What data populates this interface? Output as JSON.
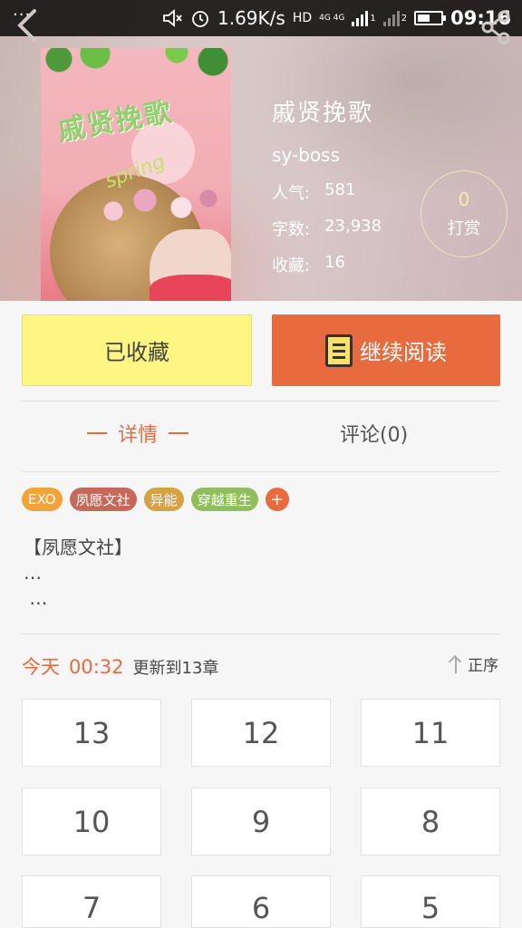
{
  "status_bar": {
    "notification_dots": "···",
    "net_speed": "1.69K/s",
    "hd_label": "HD",
    "network_label": "4G 4G",
    "sim_labels": [
      "1",
      "2"
    ],
    "time": "09:16"
  },
  "book": {
    "title": "戚贤挽歌",
    "author": "sy-boss",
    "stats": [
      {
        "label": "人气:",
        "value": "581"
      },
      {
        "label": "字数:",
        "value": "23,938"
      },
      {
        "label": "收藏:",
        "value": "16"
      }
    ],
    "cover_title": "戚贤挽歌",
    "cover_subtitle": "spring"
  },
  "tip": {
    "count": "0",
    "label": "打赏"
  },
  "actions": {
    "favorited_label": "已收藏",
    "continue_label": "继续阅读"
  },
  "tabs": {
    "detail": "详情",
    "comments": "评论(0)"
  },
  "tags": [
    {
      "label": "EXO",
      "color": "#f0a43a"
    },
    {
      "label": "夙愿文社",
      "color": "#c46a58"
    },
    {
      "label": "异能",
      "color": "#d7a342"
    },
    {
      "label": "穿越重生",
      "color": "#8fbf5a"
    }
  ],
  "tag_add": "+",
  "description": [
    "【夙愿文社】",
    "…",
    " …"
  ],
  "update": {
    "day": "今天",
    "time": "00:32",
    "text": "更新到13章",
    "sort_label": "正序"
  },
  "chapters": [
    "13",
    "12",
    "11",
    "10",
    "9",
    "8",
    "7",
    "6",
    "5"
  ],
  "colors": {
    "accent": "#e86b3f",
    "favorite_bg": "#fdf683"
  }
}
